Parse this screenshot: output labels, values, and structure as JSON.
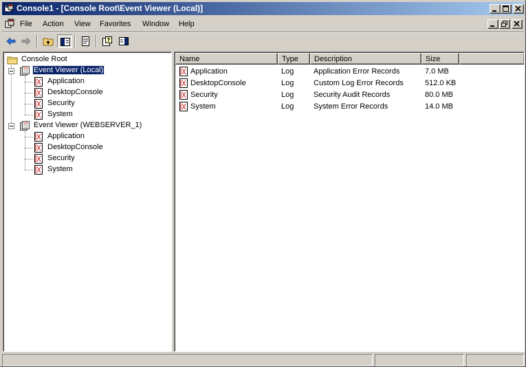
{
  "window": {
    "title": "Console1 - [Console Root\\Event Viewer (Local)]"
  },
  "menu": {
    "items": [
      "File",
      "Action",
      "View",
      "Favorites",
      "Window",
      "Help"
    ]
  },
  "tree": {
    "root": "Console Root",
    "groups": [
      {
        "label": "Event Viewer (Local)",
        "selected": true,
        "children": [
          "Application",
          "DesktopConsole",
          "Security",
          "System"
        ]
      },
      {
        "label": "Event Viewer (WEBSERVER_1)",
        "selected": false,
        "children": [
          "Application",
          "DesktopConsole",
          "Security",
          "System"
        ]
      }
    ]
  },
  "list": {
    "columns": [
      "Name",
      "Type",
      "Description",
      "Size"
    ],
    "rows": [
      {
        "name": "Application",
        "type": "Log",
        "description": "Application Error Records",
        "size": "7.0 MB"
      },
      {
        "name": "DesktopConsole",
        "type": "Log",
        "description": "Custom Log Error Records",
        "size": "512.0 KB"
      },
      {
        "name": "Security",
        "type": "Log",
        "description": "Security Audit Records",
        "size": "80.0 MB"
      },
      {
        "name": "System",
        "type": "Log",
        "description": "System Error Records",
        "size": "14.0 MB"
      }
    ]
  },
  "icons": {
    "titlebar": "mmc-console-icon",
    "log": "event-log-icon",
    "folder": "folder-icon",
    "event_viewer": "event-viewer-icon"
  },
  "colors": {
    "title_start": "#0a246a",
    "title_end": "#a6caf0",
    "selection": "#0a246a",
    "face": "#d4d0c8"
  }
}
